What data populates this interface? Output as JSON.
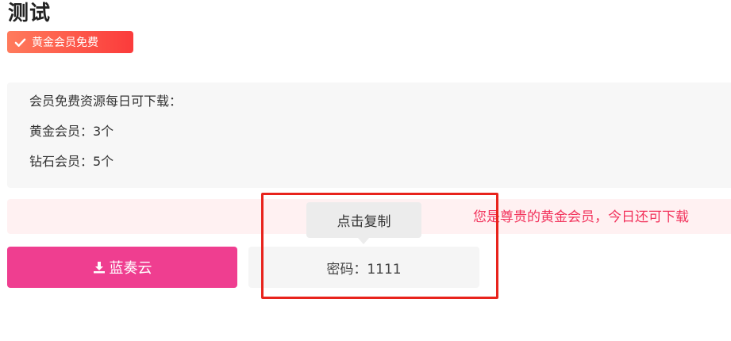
{
  "page": {
    "title": "测试"
  },
  "badge": {
    "icon": "check-icon",
    "label": "黄金会员免费",
    "color_start": "#ff7b5c",
    "color_end": "#fb3b3b"
  },
  "info": {
    "lines": [
      "会员免费资源每日可下载：",
      "黄金会员：3个",
      "钻石会员：5个"
    ]
  },
  "notice": {
    "text": "您是尊贵的黄金会员，今日还可下载",
    "color": "#f2335c"
  },
  "download": {
    "icon": "download-icon",
    "label": "蓝奏云",
    "color": "#ef3e90"
  },
  "password": {
    "label": "密码：1111"
  },
  "tooltip": {
    "label": "点击复制"
  },
  "annotation": {
    "color": "#e8231c"
  }
}
